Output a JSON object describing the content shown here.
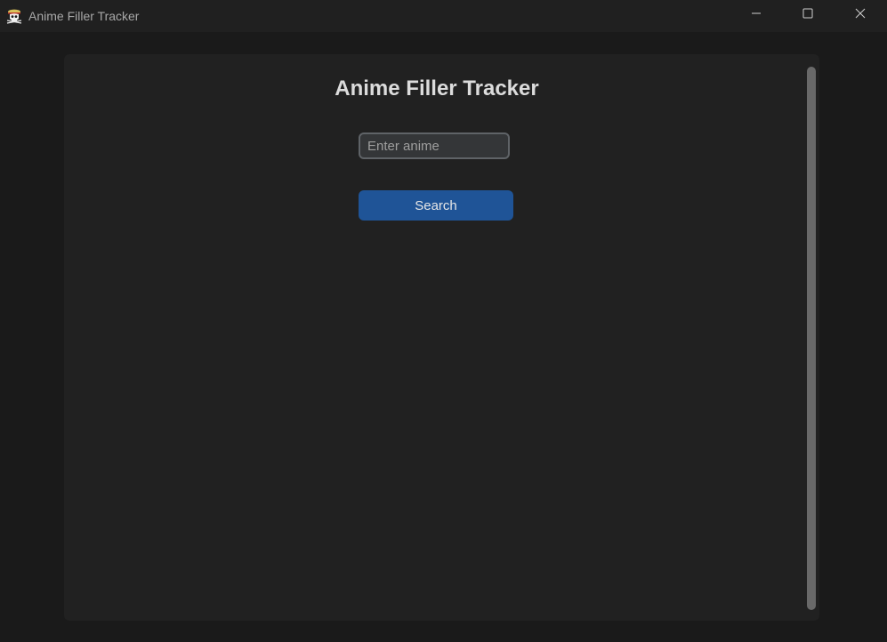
{
  "window": {
    "title": "Anime Filler Tracker",
    "icon": "pirate-skull-icon",
    "controls": [
      "minimize-icon",
      "maximize-icon",
      "close-icon"
    ]
  },
  "main": {
    "heading": "Anime Filler Tracker",
    "search": {
      "placeholder": "Enter anime",
      "value": ""
    },
    "search_button_label": "Search"
  },
  "colors": {
    "window_bg": "#1a1a1a",
    "panel_bg": "#212121",
    "accent": "#1f5497",
    "input_bg": "#343638",
    "input_border": "#5f6367",
    "scrollbar": "#696969"
  }
}
